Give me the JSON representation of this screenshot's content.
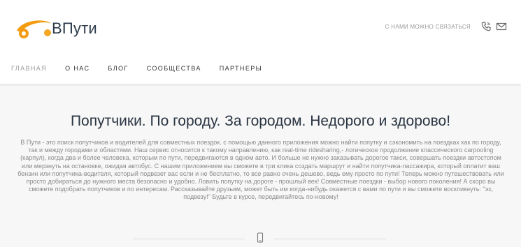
{
  "header": {
    "logo_text": "ВПути",
    "contact_label": "С нами можно связаться",
    "contact_icons": [
      "phone-icon",
      "mail-icon"
    ]
  },
  "nav": {
    "items": [
      {
        "label": "Главная",
        "active": true
      },
      {
        "label": "О нас",
        "active": false
      },
      {
        "label": "Блог",
        "active": false
      },
      {
        "label": "Сообщества",
        "active": false
      },
      {
        "label": "Партнеры",
        "active": false
      }
    ]
  },
  "main": {
    "headline": "Попутчики. По городу. За городом. Недорого и здорово!",
    "intro": "В Пути - это поиск попутчиков и водителей для совместных поездок. с помощью данного приложения можно найти попутку и сэкономить на поездках как по городу, так и между городами и областями. Наш сервис относится к такому направлению, как real-time ridesharing,- логическое продолжение классического carpooling (карпул), когда два и более человека, которым по пути, передвигаются в одном авто. И больше не нужно заказывать дорогое такси, совершать поездки автостопом или мерзнуть на остановке, ожидая автобус. С нашим приложением вы сможете в три клика создать маршрут и найти попутчика-пассажира, который оплатит ваш бензин или попутчика-водителя, который подвезет вас если и не бесплатно, то все равно очень дешево, ведь ему просто по пути! Теперь можно путешествовать или просто добираться до нужного места безопасно и удобно. Ловить попутку на дороге - прошлый век! Совместные поездки - выбор нового поколения! А скоро вы сможете подобрать попутчиков и по интересам. Рассказывайте друзьям, может быть им когда-нибудь окажется с вами по пути и вы сможете воскликнуть: \"эх, подвезу!\" Будьте в курсе, передвигайтесь по-новому!",
    "divider_icon": "smartphone-icon"
  },
  "colors": {
    "brand_orange": "#f39c12",
    "headline": "#2a3542",
    "text_muted": "#8a8a8a"
  }
}
